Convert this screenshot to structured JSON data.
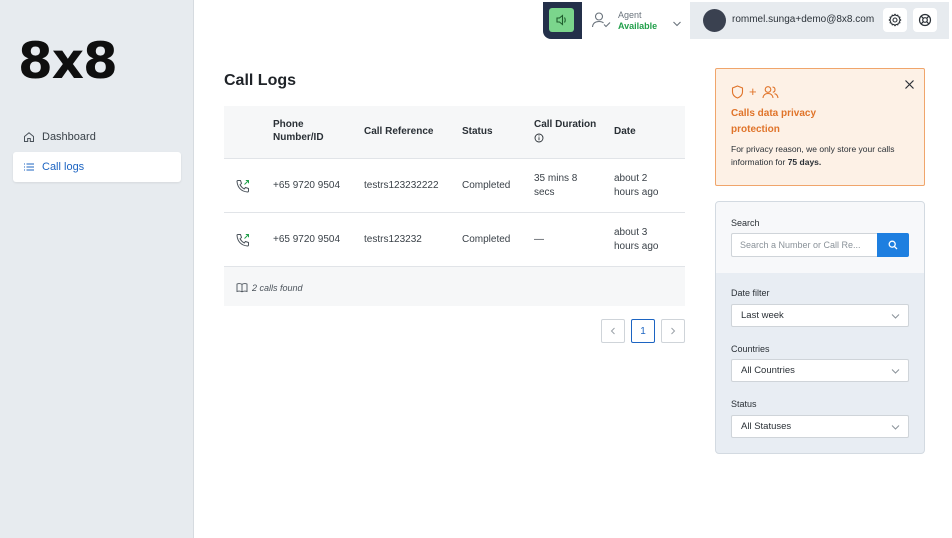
{
  "sidebar": {
    "logo": "8x8",
    "items": [
      {
        "label": "Dashboard",
        "icon": "home-icon"
      },
      {
        "label": "Call logs",
        "icon": "list-icon"
      }
    ]
  },
  "topbar": {
    "agent_label": "Agent",
    "agent_status": "Available",
    "email": "rommel.sunga+demo@8x8.com"
  },
  "main": {
    "title": "Call Logs",
    "columns": [
      "Phone Number/ID",
      "Call Reference",
      "Status",
      "Call Duration",
      "Date"
    ],
    "rows": [
      {
        "phone": "+65 9720 9504",
        "reference": "testrs123232222",
        "status": "Completed",
        "duration": "35 mins 8 secs",
        "date": "about 2 hours ago"
      },
      {
        "phone": "+65 9720 9504",
        "reference": "testrs123232",
        "status": "Completed",
        "duration": "—",
        "date": "about 3 hours ago"
      }
    ],
    "found_text": "2 calls found",
    "pagination": {
      "current": "1"
    }
  },
  "privacy": {
    "title": "Calls data privacy protection",
    "text_before": "For privacy reason, we only store your calls information for ",
    "text_bold": "75 days.",
    "accent": "#e0742a"
  },
  "filters": {
    "search_label": "Search",
    "search_placeholder": "Search a Number or Call Re...",
    "date_label": "Date filter",
    "date_value": "Last week",
    "countries_label": "Countries",
    "countries_value": "All Countries",
    "status_label": "Status",
    "status_value": "All Statuses"
  }
}
